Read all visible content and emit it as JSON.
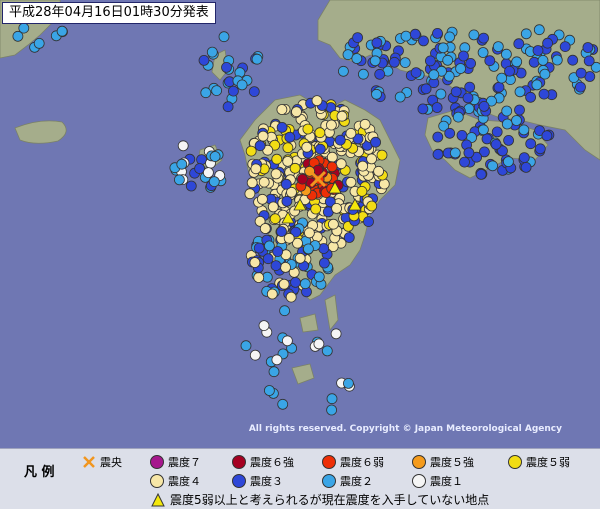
{
  "header": {
    "title": "平成28年04月16日01時30分発表"
  },
  "credit": {
    "copyright": "All rights reserved. Copyright © Japan Meteorological Agency"
  },
  "legend": {
    "title": "凡 例",
    "epicenter_label": "震央",
    "items": [
      {
        "label": "震度７",
        "color": "#a6178d"
      },
      {
        "label": "震度６強",
        "color": "#a50021"
      },
      {
        "label": "震度６弱",
        "color": "#ee2f06"
      },
      {
        "label": "震度５強",
        "color": "#f59b1c"
      },
      {
        "label": "震度５弱",
        "color": "#f2dd14"
      },
      {
        "label": "震度４",
        "color": "#f7e7a7"
      },
      {
        "label": "震度３",
        "color": "#2e47d8"
      },
      {
        "label": "震度２",
        "color": "#3aa5e6"
      },
      {
        "label": "震度１",
        "color": "#f5f5f5"
      }
    ],
    "unreported_label": "震度5弱以上と考えられるが現在震度を入手していない地点",
    "unreported_color": "#f4e80b"
  },
  "colors": {
    "sea": "#6f77b3",
    "land": "#a5ad8b",
    "epicenter": "#f1961f"
  }
}
